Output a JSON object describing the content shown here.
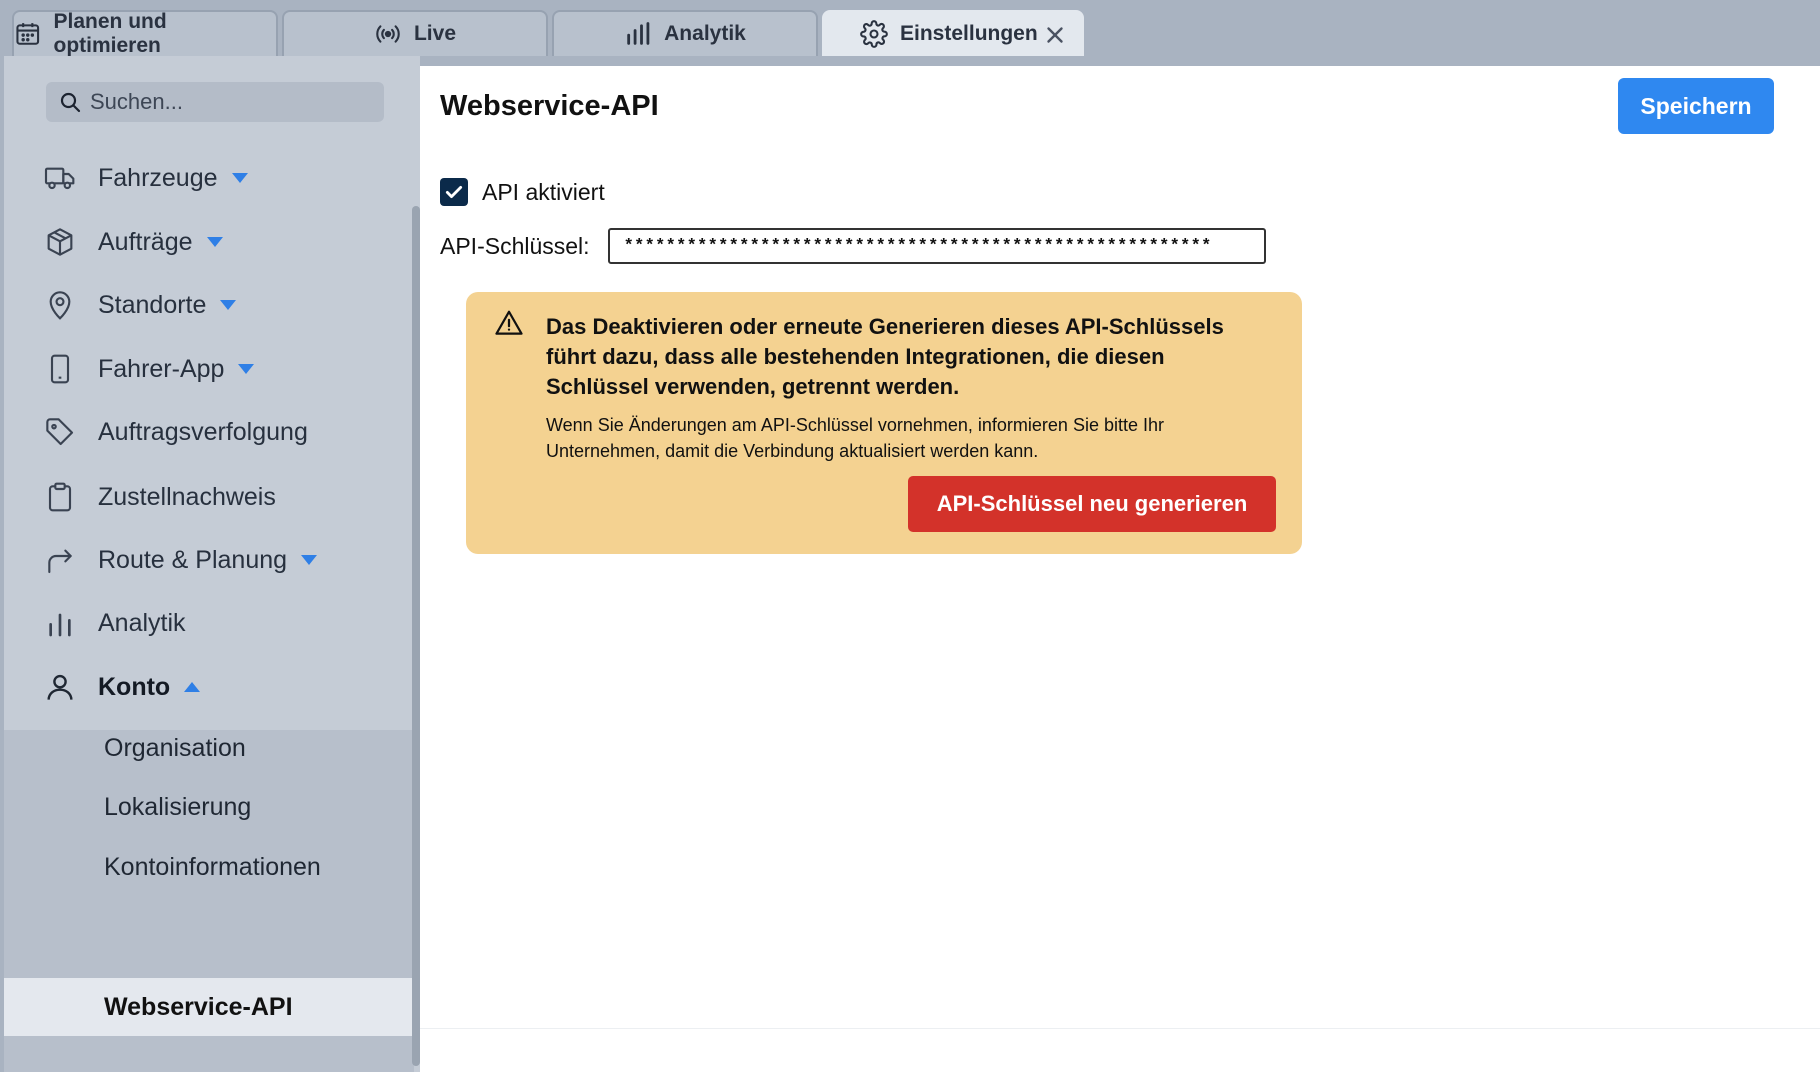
{
  "tabs": [
    {
      "label": "Planen und optimieren",
      "icon": "calendar-icon"
    },
    {
      "label": "Live",
      "icon": "broadcast-icon"
    },
    {
      "label": "Analytik",
      "icon": "bar-chart-icon"
    },
    {
      "label": "Einstellungen",
      "icon": "gear-icon",
      "active": true
    }
  ],
  "search": {
    "placeholder": "Suchen..."
  },
  "sidebar": {
    "items": [
      {
        "label": "Fahrzeuge",
        "icon": "truck-icon",
        "expandable": true
      },
      {
        "label": "Aufträge",
        "icon": "package-icon",
        "expandable": true
      },
      {
        "label": "Standorte",
        "icon": "map-pin-icon",
        "expandable": true
      },
      {
        "label": "Fahrer-App",
        "icon": "smartphone-icon",
        "expandable": true
      },
      {
        "label": "Auftragsverfolgung",
        "icon": "tag-icon",
        "expandable": false
      },
      {
        "label": "Zustellnachweis",
        "icon": "clipboard-icon",
        "expandable": false
      },
      {
        "label": "Route & Planung",
        "icon": "route-arrow-icon",
        "expandable": true
      },
      {
        "label": "Analytik",
        "icon": "bar-chart-icon",
        "expandable": false
      }
    ],
    "konto": {
      "label": "Konto",
      "icon": "user-icon",
      "children": [
        "Organisation",
        "Lokalisierung",
        "Kontoinformationen",
        "Webservice-API"
      ],
      "active_child": "Webservice-API"
    }
  },
  "main": {
    "title": "Webservice-API",
    "save_label": "Speichern",
    "api_enabled_label": "API aktiviert",
    "api_enabled": true,
    "api_key_label": "API-Schlüssel:",
    "api_key_value": "********************************************************",
    "warning": {
      "title": "Das Deaktivieren oder erneute Generieren dieses API-Schlüssels führt dazu, dass alle bestehenden Integrationen, die diesen Schlüssel verwenden, getrennt werden.",
      "body": "Wenn Sie Änderungen am API-Schlüssel vornehmen, informieren Sie bitte Ihr Unternehmen, damit die Verbindung aktualisiert werden kann.",
      "regen_label": "API-Schlüssel neu generieren"
    }
  },
  "colors": {
    "accent": "#2f88f0",
    "danger": "#d3322a",
    "warning_bg": "#f4d291",
    "caret": "#2f7fe6"
  }
}
